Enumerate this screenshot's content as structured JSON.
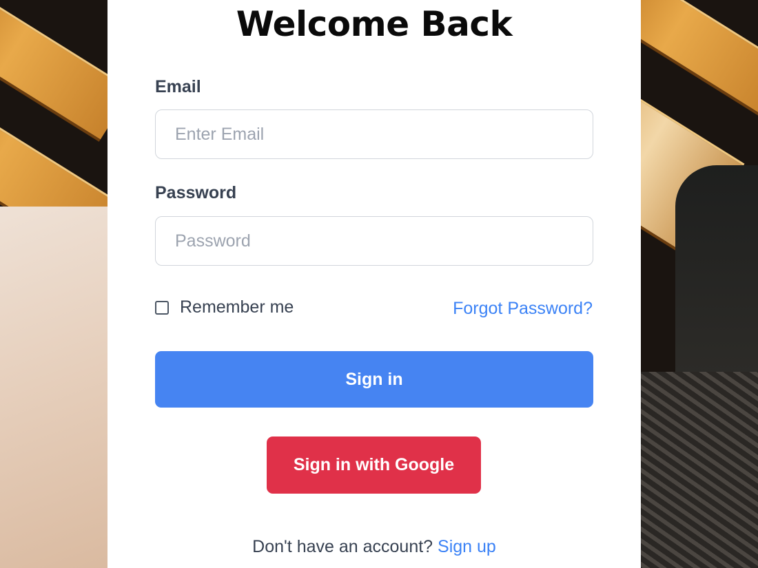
{
  "form": {
    "title": "Welcome Back",
    "email_label": "Email",
    "email_placeholder": "Enter Email",
    "email_value": "",
    "password_label": "Password",
    "password_placeholder": "Password",
    "password_value": "",
    "remember_label": "Remember me",
    "remember_checked": false,
    "forgot_label": "Forgot Password?",
    "signin_label": "Sign in",
    "google_label": "Sign in with Google",
    "signup_prompt": "Don't have an account?",
    "signup_label": "Sign up"
  },
  "colors": {
    "primary": "#4684f2",
    "google": "#e03149",
    "link": "#3b82f6"
  }
}
